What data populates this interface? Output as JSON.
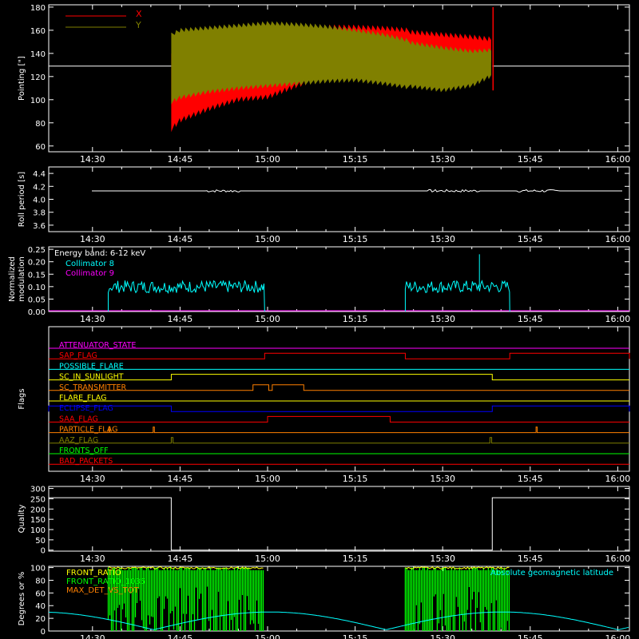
{
  "colors": {
    "background": "#000000",
    "axes": "#ffffff",
    "x_series": "#ff0000",
    "y_series": "#808000",
    "collimator8": "#00ffff",
    "collimator9": "#ff00ff",
    "front_ratio": "#ffff00",
    "front_ratio_1000": "#00ff00",
    "max_det": "#ff8000",
    "latitude": "#00ffff"
  },
  "time_axis": {
    "ticks": [
      "14:30",
      "14:45",
      "15:00",
      "15:15",
      "15:30",
      "15:45",
      "16:00"
    ],
    "tick_minutes": [
      870,
      885,
      900,
      915,
      930,
      945,
      960
    ],
    "range_minutes": [
      862.5,
      962
    ]
  },
  "chart_data": [
    {
      "id": "pointing",
      "type": "line",
      "ylabel": "Pointing [\"]",
      "ylim": [
        55,
        182
      ],
      "y_ticks": [
        "60",
        "80",
        "100",
        "120",
        "140",
        "160",
        "180"
      ],
      "y_tick_values": [
        60,
        80,
        100,
        120,
        140,
        160,
        180
      ],
      "reference_line": 129,
      "data_start": 883.5,
      "data_end": 938.5,
      "legend": [
        {
          "label": "X",
          "color": "#ff0000"
        },
        {
          "label": "Y",
          "color": "#808000"
        }
      ],
      "y_envelope": {
        "time": [
          883.5,
          885,
          890,
          895,
          900,
          905,
          910,
          915,
          920,
          925,
          930,
          935,
          938.5
        ],
        "upper": [
          158,
          162,
          164,
          166,
          168,
          167,
          165,
          162,
          158,
          152,
          148,
          145,
          146
        ],
        "lower": [
          96,
          100,
          105,
          108,
          110,
          112,
          114,
          115,
          112,
          108,
          105,
          109,
          118
        ]
      },
      "x_envelope": {
        "time": [
          883.5,
          885,
          890,
          895,
          900,
          905,
          910,
          915,
          920,
          925,
          930,
          935,
          938.5
        ],
        "upper": [
          140,
          142,
          148,
          153,
          158,
          163,
          165,
          165,
          164,
          162,
          160,
          158,
          156
        ],
        "lower": [
          72,
          80,
          90,
          98,
          100,
          110,
          118,
          125,
          128,
          130,
          132,
          130,
          128
        ]
      }
    },
    {
      "id": "roll",
      "type": "line",
      "ylabel": "Roll period [s]",
      "ylim": [
        3.5,
        4.5
      ],
      "y_ticks": [
        "3.6",
        "3.8",
        "4.0",
        "4.2",
        "4.4"
      ],
      "y_tick_values": [
        3.6,
        3.8,
        4.0,
        4.2,
        4.4
      ],
      "value": 4.13
    },
    {
      "id": "modulation",
      "type": "line",
      "ylabel": "Normalized modulation",
      "ylim": [
        0,
        0.26
      ],
      "y_ticks": [
        "0.00",
        "0.05",
        "0.10",
        "0.15",
        "0.20",
        "0.25"
      ],
      "y_tick_values": [
        0,
        0.05,
        0.1,
        0.15,
        0.2,
        0.25
      ],
      "annotation": "Energy band: 6-12 keV",
      "legend": [
        {
          "label": "Collimator 8",
          "color": "#00ffff"
        },
        {
          "label": "Collimator 9",
          "color": "#ff00ff"
        }
      ],
      "segments": [
        [
          872.7,
          899.5
        ],
        [
          923.6,
          941.5
        ]
      ],
      "mean": 0.1,
      "spike": {
        "time": 936.3,
        "value": 0.23
      }
    },
    {
      "id": "flags",
      "type": "line",
      "ylabel": "Flags",
      "flags": [
        {
          "label": "ATTENUATOR_STATE",
          "color": "#ff00ff",
          "changes": []
        },
        {
          "label": "SAP_FLAG",
          "color": "#ff0000",
          "changes": [
            [
              899.5,
              923.6
            ],
            [
              941.5,
              962
            ]
          ]
        },
        {
          "label": "POSSIBLE_FLARE",
          "color": "#00ffff",
          "changes": []
        },
        {
          "label": "SC_IN_SUNLIGHT",
          "color": "#ffff00",
          "changes": [
            [
              883.5,
              938.5
            ]
          ]
        },
        {
          "label": "SC_TRANSMITTER",
          "color": "#ff8000",
          "changes": [
            [
              897.5,
              900.2
            ],
            [
              900.8,
              906.2
            ]
          ]
        },
        {
          "label": "FLARE_FLAG",
          "color": "#ffff00",
          "changes": []
        },
        {
          "label": "ECLIPSE_FLAG",
          "color": "#0000ff",
          "changes": [
            [
              862.5,
              883.5
            ],
            [
              938.5,
              962
            ]
          ]
        },
        {
          "label": "SAA_FLAG",
          "color": "#ff0000",
          "changes": [
            [
              900.0,
              921.0
            ]
          ]
        },
        {
          "label": "PARTICLE_FLAG",
          "color": "#ff8000",
          "changes": [
            [
              872.8,
              873.0
            ],
            [
              880.4,
              880.6
            ],
            [
              946.0,
              946.2
            ]
          ]
        },
        {
          "label": "AAZ_FLAG",
          "color": "#808000",
          "changes": [
            [
              883.5,
              883.8
            ],
            [
              938.1,
              938.4
            ]
          ]
        },
        {
          "label": "FRONTS_OFF",
          "color": "#00ff00",
          "changes": []
        },
        {
          "label": "BAD_PACKETS",
          "color": "#ff0000",
          "changes": []
        }
      ]
    },
    {
      "id": "quality",
      "type": "line",
      "ylabel": "Quality",
      "ylim": [
        -5,
        310
      ],
      "y_ticks": [
        "0",
        "50",
        "100",
        "150",
        "200",
        "250",
        "300"
      ],
      "y_tick_values": [
        0,
        50,
        100,
        150,
        200,
        250,
        300
      ],
      "steps": [
        [
          862.5,
          255
        ],
        [
          883.5,
          255
        ],
        [
          883.5,
          0
        ],
        [
          938.5,
          0
        ],
        [
          938.5,
          255
        ],
        [
          962,
          255
        ]
      ]
    },
    {
      "id": "geomag",
      "type": "bar",
      "ylabel": "Degrees or %",
      "ylim": [
        0,
        102
      ],
      "y_ticks": [
        "0",
        "20",
        "40",
        "60",
        "80",
        "100"
      ],
      "y_tick_values": [
        0,
        20,
        40,
        60,
        80,
        100
      ],
      "legend_left": [
        {
          "label": "FRONT_RATIO",
          "color": "#ffff00"
        },
        {
          "label": "FRONT_RATIO_1035",
          "color": "#00ff00"
        },
        {
          "label": "MAX_DET_VS_TOT",
          "color": "#ff8000"
        }
      ],
      "legend_right": "Absolute geomagnetic latitude",
      "segments": [
        [
          872.7,
          899.5
        ],
        [
          923.6,
          941.5
        ]
      ],
      "latitude_range": [
        2,
        30
      ]
    }
  ]
}
